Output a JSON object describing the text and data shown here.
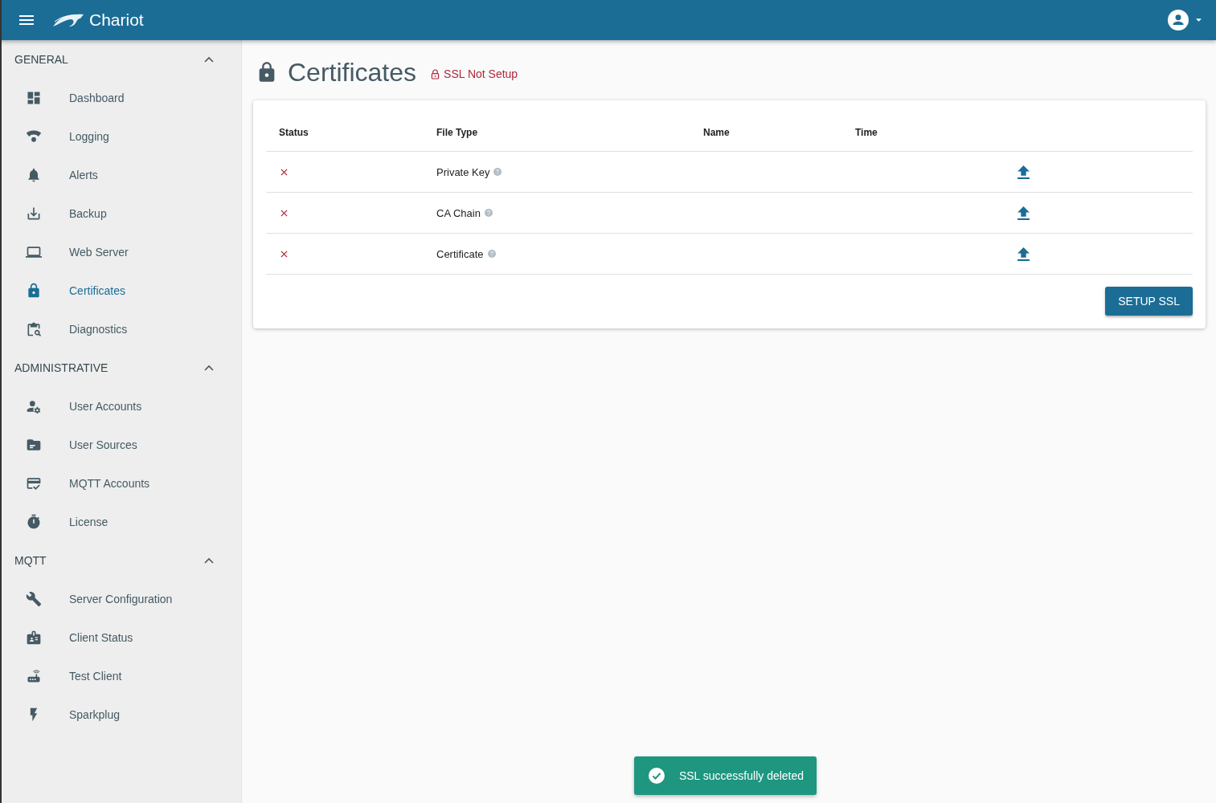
{
  "app_bar": {
    "brand": "Chariot"
  },
  "sidebar": {
    "sections": [
      {
        "title": "GENERAL",
        "expanded": true,
        "items": [
          {
            "label": "Dashboard",
            "selected": false
          },
          {
            "label": "Logging",
            "selected": false
          },
          {
            "label": "Alerts",
            "selected": false
          },
          {
            "label": "Backup",
            "selected": false
          },
          {
            "label": "Web Server",
            "selected": false
          },
          {
            "label": "Certificates",
            "selected": true
          },
          {
            "label": "Diagnostics",
            "selected": false
          }
        ]
      },
      {
        "title": "ADMINISTRATIVE",
        "expanded": true,
        "items": [
          {
            "label": "User Accounts",
            "selected": false
          },
          {
            "label": "User Sources",
            "selected": false
          },
          {
            "label": "MQTT Accounts",
            "selected": false
          },
          {
            "label": "License",
            "selected": false
          }
        ]
      },
      {
        "title": "MQTT",
        "expanded": true,
        "items": [
          {
            "label": "Server Configuration",
            "selected": false
          },
          {
            "label": "Client Status",
            "selected": false
          },
          {
            "label": "Test Client",
            "selected": false
          },
          {
            "label": "Sparkplug",
            "selected": false
          }
        ]
      }
    ]
  },
  "page": {
    "title": "Certificates",
    "ssl_status": "SSL Not Setup"
  },
  "table": {
    "columns": [
      "Status",
      "File Type",
      "Name",
      "Time"
    ],
    "rows": [
      {
        "ok": false,
        "file_type": "Private Key"
      },
      {
        "ok": false,
        "file_type": "CA Chain"
      },
      {
        "ok": false,
        "file_type": "Certificate"
      }
    ]
  },
  "setup_button": "SETUP SSL",
  "toast": {
    "message": "SSL successfully deleted"
  }
}
